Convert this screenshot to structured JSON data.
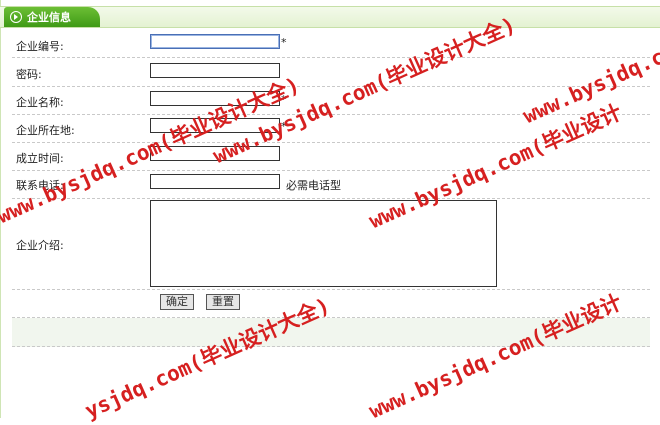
{
  "panel": {
    "title": "企业信息"
  },
  "form": {
    "fields": [
      {
        "label": "企业编号:",
        "value": "",
        "required": "*"
      },
      {
        "label": "密码:",
        "value": ""
      },
      {
        "label": "企业名称:",
        "value": "",
        "required": "*"
      },
      {
        "label": "企业所在地:",
        "value": "",
        "required": "*"
      },
      {
        "label": "成立时间:",
        "value": ""
      },
      {
        "label": "联系电话:",
        "value": "",
        "hint": "必需电话型"
      }
    ],
    "intro": {
      "label": "企业介绍:",
      "value": ""
    },
    "buttons": {
      "confirm": "确定",
      "reset": "重置"
    }
  },
  "watermarks": [
    "www.bysjdq.com(毕业设计大全)",
    "www.bysjdq.com(毕业设计",
    "www.bysjdq.com(毕业设计大全)",
    "www.bysjdq.com(毕业设计",
    "ysjdq.com(毕业设计大全)",
    "www.bysjdq.com(毕业设计"
  ],
  "colors": {
    "accent": "#4a9e1c",
    "watermark": "#d62020"
  }
}
